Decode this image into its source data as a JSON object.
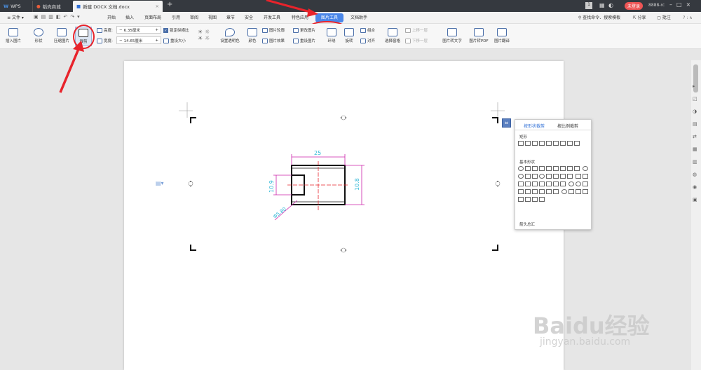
{
  "titlebar": {
    "wps": "WPS",
    "tab_store": "稻壳商城",
    "tab_doc": "新建 DOCX 文档.docx",
    "new_tab": "+",
    "user_badge": "未登录",
    "login_label": "8888-rc"
  },
  "menu": {
    "file": "文件",
    "items": [
      "开始",
      "插入",
      "页面布局",
      "引用",
      "审阅",
      "视图",
      "章节",
      "安全",
      "开发工具",
      "特色应用",
      "图片工具",
      "文档助手"
    ],
    "search": "查找命令、搜索模板",
    "share": "分享",
    "comment": "批注"
  },
  "ribbon": {
    "insert_pic": "插入图片",
    "shape": "形状",
    "compress": "压缩图片",
    "crop": "裁剪",
    "height_label": "高度:",
    "height_value": "6.35厘米",
    "width_label": "宽度:",
    "width_value": "14.65厘米",
    "lock_ratio": "锁定纵横比",
    "reset_size": "重设大小",
    "transparent": "设置透明色",
    "color": "颜色",
    "outline": "图片轮廓",
    "effect": "图片效果",
    "change_pic": "更改图片",
    "reset_pic": "重设图片",
    "wrap": "环绕",
    "rotate": "旋转",
    "align": "对齐",
    "group": "组合",
    "select_pane": "选择窗格",
    "bring_forward": "上移一层",
    "send_backward": "下移一层",
    "to_text": "图片转文字",
    "to_pdf": "图片转PDF",
    "translate": "图片翻译"
  },
  "crop_panel": {
    "tab_shape": "按形状裁剪",
    "tab_ratio": "按比例裁剪",
    "section_rect": "矩形",
    "section_basic": "基本形状",
    "section_arrow": "箭头总汇"
  },
  "drawing": {
    "dim_top": "25",
    "dim_left": "10.9",
    "dim_right": "10.8",
    "dim_diag": "Φ5.80"
  },
  "colors": {
    "accent": "#2f6fd6",
    "annotation_red": "#e8232b",
    "dimension_cyan": "#2fb7d6",
    "dimension_magenta": "#cc22aa"
  },
  "watermark": {
    "brand": "Baidu经验",
    "url": "jingyan.baidu.com"
  }
}
